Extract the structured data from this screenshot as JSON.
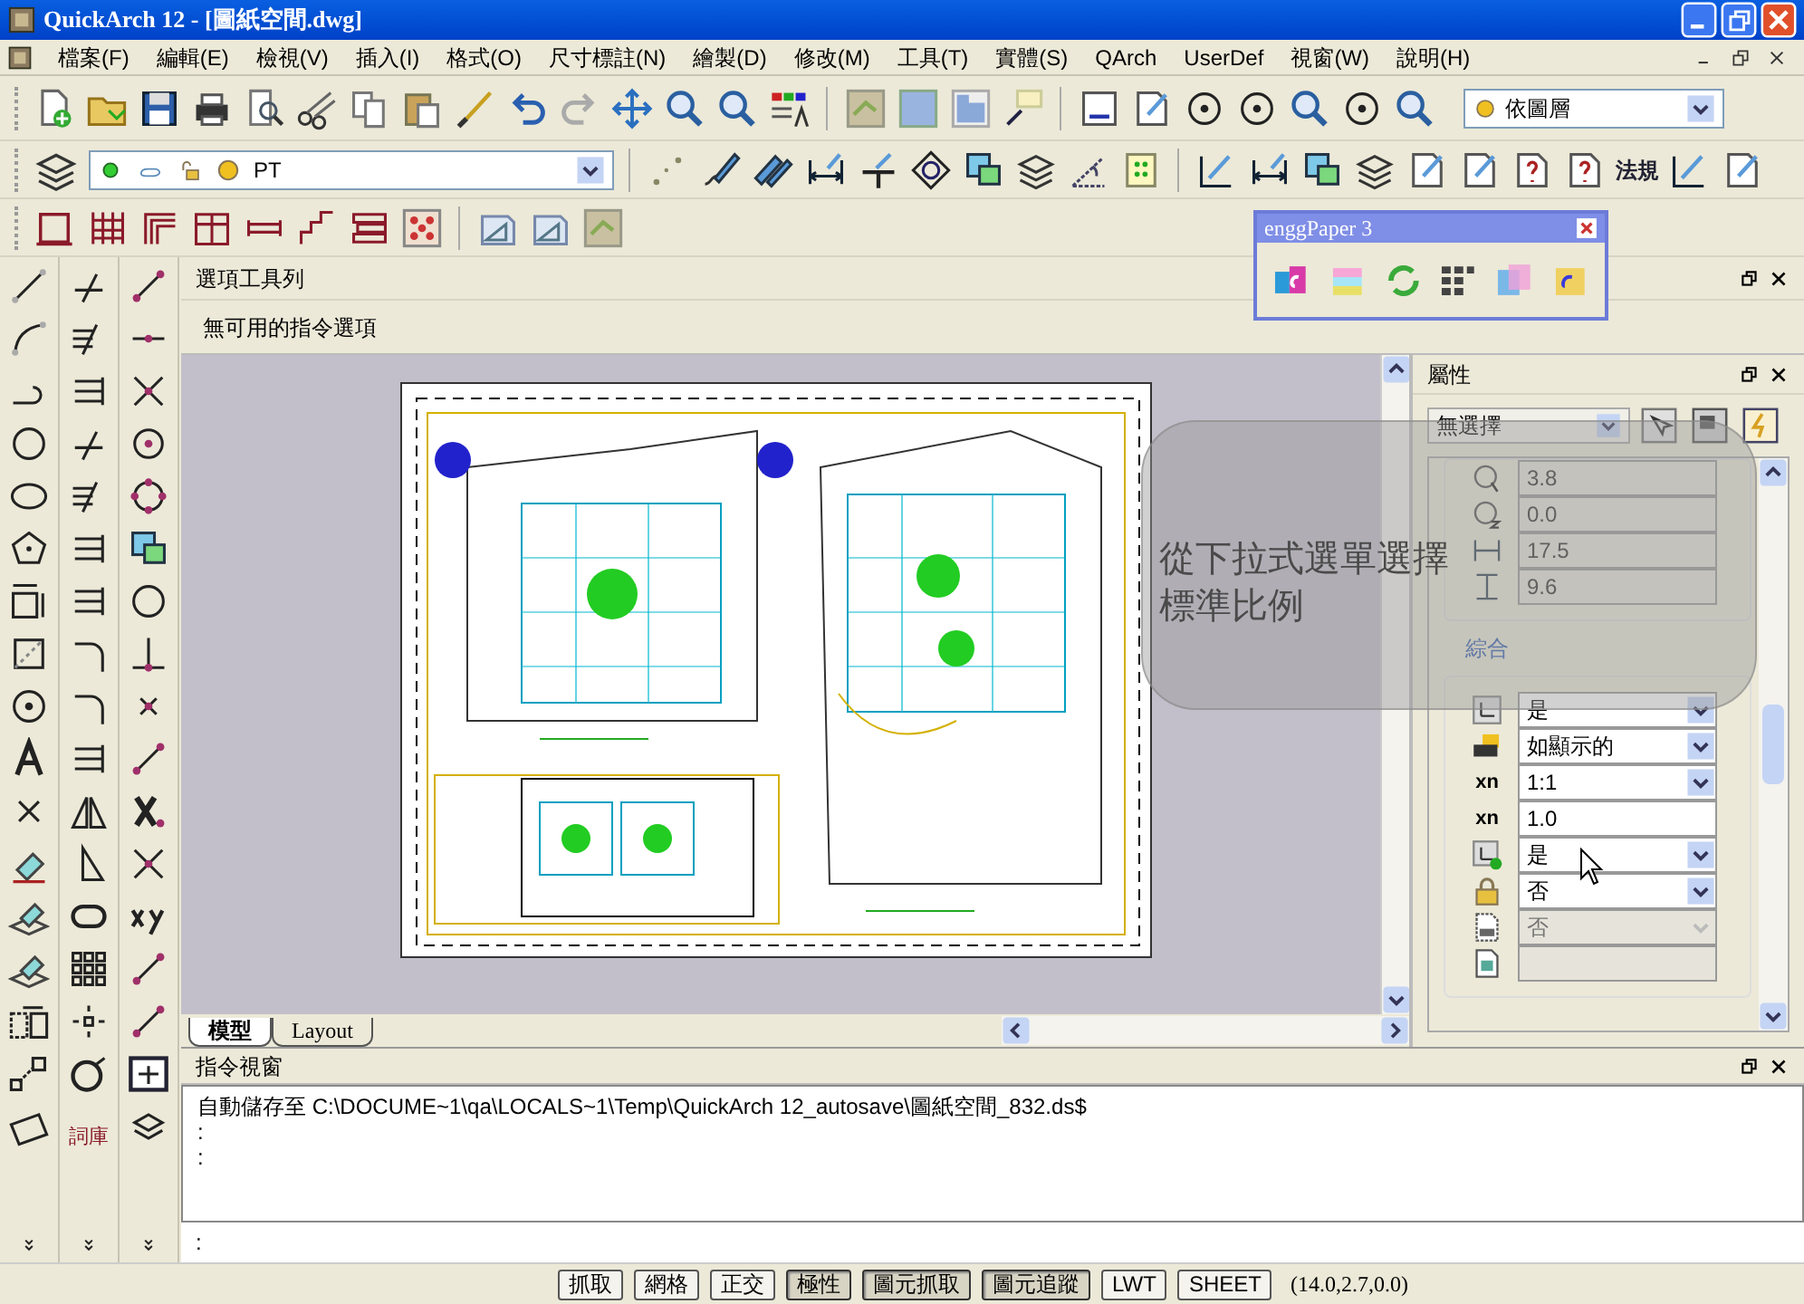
{
  "window": {
    "title": "QuickArch 12 - [圖紙空間.dwg]"
  },
  "menu": [
    "檔案(F)",
    "編輯(E)",
    "檢視(V)",
    "插入(I)",
    "格式(O)",
    "尺寸標註(N)",
    "繪製(D)",
    "修改(M)",
    "工具(T)",
    "實體(S)",
    "QArch",
    "UserDef",
    "視窗(W)",
    "說明(H)"
  ],
  "toolbars": {
    "color_dropdown": "依圖層",
    "layer_dropdown": "PT",
    "code_label": "法規"
  },
  "options_toolbar": {
    "title": "選項工具列",
    "message": "無可用的指令選項"
  },
  "floating_toolbar": {
    "title": "enggPaper 3"
  },
  "left_toolbar": {
    "library_label": "詞庫"
  },
  "layout_tabs": [
    {
      "label": "模型",
      "selected": true
    },
    {
      "label": "Layout",
      "selected": false
    }
  ],
  "properties": {
    "title": "屬性",
    "selection": "無選擇",
    "geometry_rows": [
      {
        "kind": "readonly",
        "value": "3.8"
      },
      {
        "kind": "readonly",
        "value": "0.0"
      },
      {
        "kind": "readonly",
        "value": "17.5"
      },
      {
        "kind": "readonly",
        "value": "9.6"
      }
    ],
    "section": "綜合",
    "general_rows": [
      {
        "kind": "dropdown",
        "value": "是",
        "disabled": false
      },
      {
        "kind": "dropdown",
        "value": "如顯示的",
        "disabled": false
      },
      {
        "kind": "dropdown",
        "value": "1:1",
        "disabled": false,
        "icon_label": "xn"
      },
      {
        "kind": "text",
        "value": "1.0",
        "disabled": false,
        "icon_label": "xn"
      },
      {
        "kind": "dropdown",
        "value": "是",
        "disabled": false
      },
      {
        "kind": "dropdown",
        "value": "否",
        "disabled": false
      },
      {
        "kind": "dropdown",
        "value": "否",
        "disabled": true
      },
      {
        "kind": "text",
        "disabled": true
      }
    ]
  },
  "callout": "從下拉式選單選擇標準比例",
  "command_window": {
    "title": "指令視窗",
    "lines": [
      "自動儲存至 C:\\DOCUME~1\\qa\\LOCALS~1\\Temp\\QuickArch 12_autosave\\圖紙空間_832.ds$",
      ":",
      ":"
    ],
    "prompt": ":"
  },
  "status_bar": {
    "buttons": [
      {
        "label": "抓取",
        "on": false
      },
      {
        "label": "網格",
        "on": false
      },
      {
        "label": "正交",
        "on": false
      },
      {
        "label": "極性",
        "on": true
      },
      {
        "label": "圖元抓取",
        "on": true
      },
      {
        "label": "圖元追蹤",
        "on": true
      },
      {
        "label": "LWT",
        "on": false
      },
      {
        "label": "SHEET",
        "on": false
      }
    ],
    "coordinates": "(14.0,2.7,0.0)"
  }
}
